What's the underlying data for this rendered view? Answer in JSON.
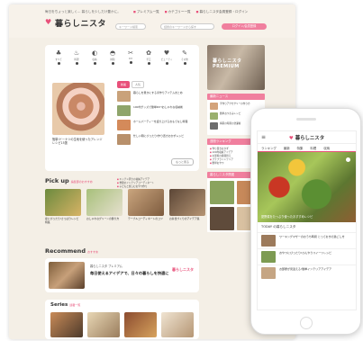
{
  "desktop": {
    "tagline": "毎日をちょっと楽しく… 暮らしを少しだけ豊かに。",
    "logo_text": "暮らしニスタ",
    "topnav": [
      "プレミアム一覧",
      "カテゴリー一覧",
      "暮らしニスタ会員登録・ログイン"
    ],
    "search_placeholder": "キーワード検索",
    "search2_placeholder": "話題のキーワードから探す",
    "post_button": "ログイン/会員登録",
    "categories": [
      {
        "icon": "♣",
        "label": "すべて"
      },
      {
        "icon": "♨",
        "label": "料理"
      },
      {
        "icon": "◐",
        "label": "収納"
      },
      {
        "icon": "◓",
        "label": "掃除"
      },
      {
        "icon": "✂",
        "label": "DIY"
      },
      {
        "icon": "✿",
        "label": "手芸"
      },
      {
        "icon": "♥",
        "label": "ビューティ"
      },
      {
        "icon": "✎",
        "label": "その他"
      }
    ],
    "tabs": [
      "新着",
      "人気"
    ],
    "featured_caption": "簡単!ドーナツの生地を使ったアレンジレシピ15選",
    "main_list": [
      "暮らしを豊かにする手作りアイテムまとめ",
      "100均グッズで簡単DIY!おしゃれな収納術",
      "ホームパーティーを盛り上げるおもてなし料理",
      "忙しい朝にぴったり!作り置きおかずレシピ"
    ],
    "bullets": [
      "キッチン周りの収納アイデア",
      "季節のインテリアコーディネート",
      "子どもと楽しむおやつ作り"
    ],
    "more": "もっと見る",
    "pickup": {
      "title": "Pick up",
      "sub": "編集部のおすすめ"
    },
    "pick_items": [
      "夏にぴったり!さっぱりレシピ特集",
      "おしゃれなグリーンの飾り方",
      "テーブルコーディネートのコツ",
      "お弁当づくりのアイデア集"
    ],
    "recommend": {
      "title": "Recommend",
      "sub": "おすすめ"
    },
    "recommend_card": {
      "label": "暮らしニスタ プレミアム",
      "headline": "毎日使えるアイデアで、日々の暮らしを快適に",
      "logo": "暮らしニスタ"
    },
    "series": {
      "title": "Series",
      "sub": "連載一覧"
    },
    "side": {
      "premium_label": "暮らしニスタ PREMIUM",
      "news_title": "最新ニュース",
      "news": [
        "手作りアクセサリーの作り方",
        "簡単おつまみレシピ",
        "梅雨の時期の洗濯術"
      ],
      "ranking_title": "週間ランキング",
      "ranking": [
        "作り置きおかず",
        "100均収納アイデア",
        "お部屋の模様替え",
        "プチプラインテリア",
        "簡単おやつ"
      ],
      "other_title": "暮らしニスタ関連"
    }
  },
  "mobile": {
    "menu_icon": "≡",
    "logo": "暮らしニスタ",
    "tabs": [
      "ランキング",
      "最新",
      "特集",
      "料理",
      "収納"
    ],
    "hero_caption": "夏野菜をたっぷり使ったおすすめレシピ",
    "section_title": "TODAY の暮らしニスタ",
    "items": [
      "ワーキングマザーのおうち時間 とっておきの過ごし方",
      "おやつにぴったり!ひんやりスイーツレシピ",
      "お部屋が見違える!簡単インテリアアイデア"
    ]
  }
}
